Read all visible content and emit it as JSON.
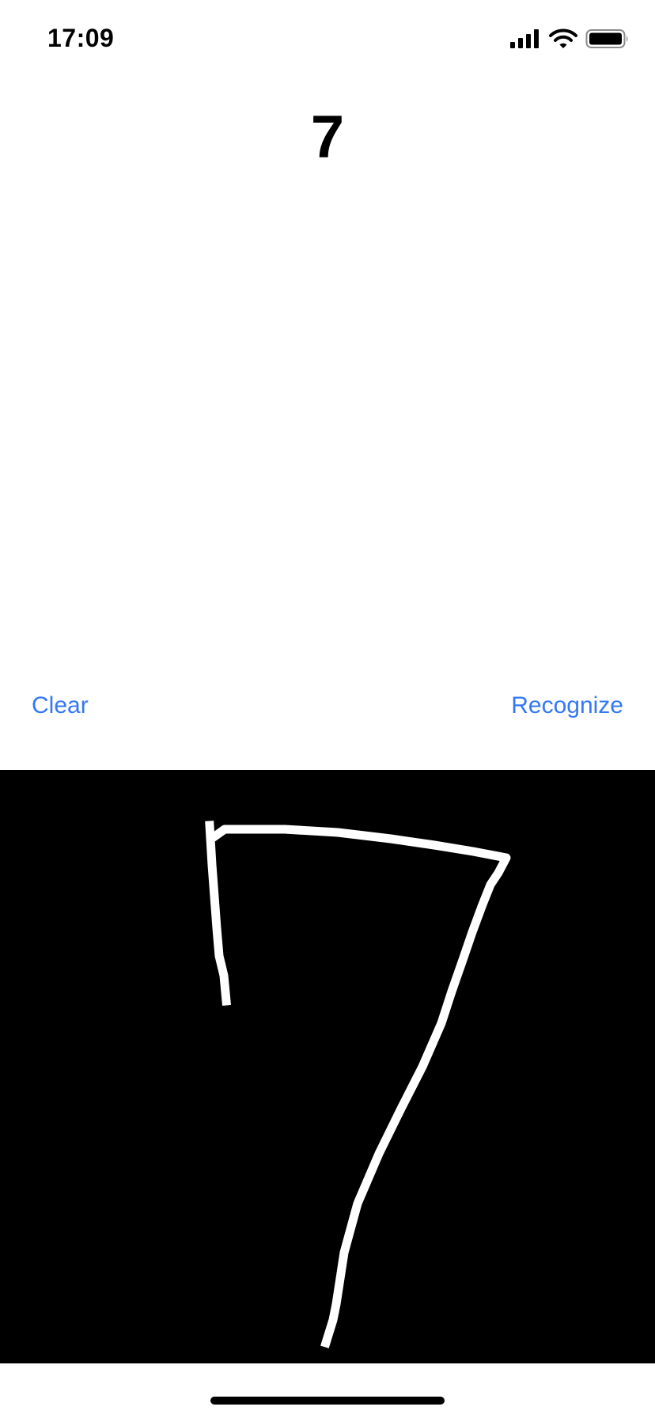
{
  "status_bar": {
    "time": "17:09",
    "icons": [
      "signal-icon",
      "wifi-icon",
      "battery-icon"
    ]
  },
  "result": {
    "text": "7"
  },
  "actions": {
    "clear_label": "Clear",
    "recognize_label": "Recognize"
  },
  "canvas": {
    "background": "#000000",
    "stroke_color": "#ffffff"
  },
  "colors": {
    "accent": "#3478F6",
    "background": "#ffffff"
  }
}
